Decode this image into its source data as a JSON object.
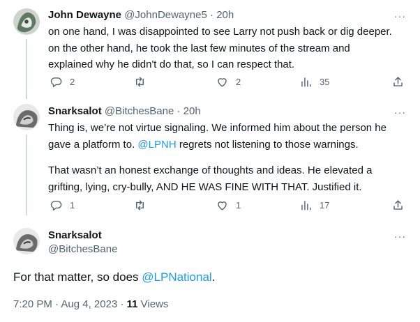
{
  "tweets": [
    {
      "author": "John Dewayne",
      "handle": "@JohnDewayne5",
      "time": "20h",
      "lines": [
        "on one hand, I was disappointed to see Larry not push back or dig deeper.",
        "on the other hand, he took the last few minutes of the stream and",
        "explained why he didn't do that,  so I can respect that."
      ],
      "replies": "2",
      "retweets": "",
      "likes": "2",
      "views": "35"
    },
    {
      "author": "Snarksalot",
      "handle": "@BitchesBane",
      "time": "20h",
      "p1_line1": "Thing is, we’re not virtue signaling. We informed him about the person he",
      "p1_line2_before": "gave a platform to. ",
      "p1_mention": "@LPNH",
      "p1_line2_after": " regrets not listening to those warnings.",
      "p2_line1": "That wasn’t an honest exchange of thoughts and ideas. He elevated a",
      "p2_line2": "grifting, lying, cry-bully, AND HE WAS FINE WITH THAT. Justified it.",
      "replies": "1",
      "retweets": "",
      "likes": "1",
      "views": "17"
    }
  ],
  "main_tweet": {
    "author": "Snarksalot",
    "handle": "@BitchesBane",
    "text_before": "For that matter, so does ",
    "mention": "@LPNational",
    "text_after": ".",
    "time": "7:20 PM",
    "date": "Aug 4, 2023",
    "views_count": "11",
    "views_label": "Views"
  },
  "more_glyph": "···",
  "separator": "·",
  "icons": [
    "reply-icon",
    "retweet-icon",
    "like-icon",
    "views-icon",
    "share-icon",
    "more-icon"
  ],
  "colors": {
    "link": "#1d9bf0",
    "secondary": "#536471",
    "text": "#0f1419",
    "thread_line": "#cfd9de"
  }
}
